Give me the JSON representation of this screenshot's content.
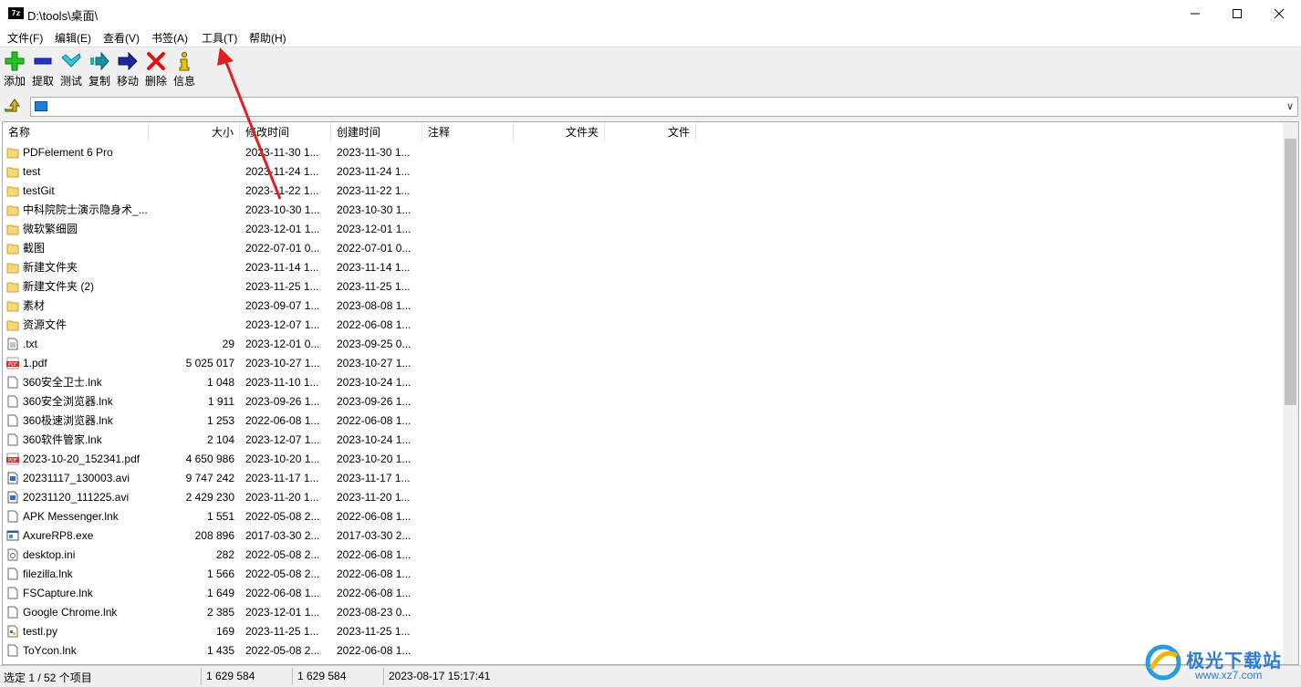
{
  "window": {
    "title": "D:\\tools\\桌面\\",
    "app_icon": "7z"
  },
  "menu": [
    "文件(F)",
    "编辑(E)",
    "查看(V)",
    "书签(A)",
    "工具(T)",
    "帮助(H)"
  ],
  "toolbar": {
    "buttons": [
      {
        "label": "添加",
        "icon": "plus-icon"
      },
      {
        "label": "提取",
        "icon": "minus-icon"
      },
      {
        "label": "测试",
        "icon": "check-icon"
      },
      {
        "label": "复制",
        "icon": "copy-arrow-icon"
      },
      {
        "label": "移动",
        "icon": "move-arrow-icon"
      },
      {
        "label": "删除",
        "icon": "delete-x-icon"
      },
      {
        "label": "信息",
        "icon": "info-icon"
      }
    ]
  },
  "columns": [
    "名称",
    "大小",
    "修改时间",
    "创建时间",
    "注释",
    "文件夹",
    "文件"
  ],
  "files": [
    {
      "name": "PDFelement 6 Pro",
      "size": "",
      "modified": "2023-11-30 1...",
      "created": "2023-11-30 1...",
      "type": "folder"
    },
    {
      "name": "test",
      "size": "",
      "modified": "2023-11-24 1...",
      "created": "2023-11-24 1...",
      "type": "folder"
    },
    {
      "name": "testGit",
      "size": "",
      "modified": "2023-11-22 1...",
      "created": "2023-11-22 1...",
      "type": "folder"
    },
    {
      "name": "中科院院士演示隐身术_...",
      "size": "",
      "modified": "2023-10-30 1...",
      "created": "2023-10-30 1...",
      "type": "folder"
    },
    {
      "name": "微软繁细圆",
      "size": "",
      "modified": "2023-12-01 1...",
      "created": "2023-12-01 1...",
      "type": "folder"
    },
    {
      "name": "截图",
      "size": "",
      "modified": "2022-07-01 0...",
      "created": "2022-07-01 0...",
      "type": "folder"
    },
    {
      "name": "新建文件夹",
      "size": "",
      "modified": "2023-11-14 1...",
      "created": "2023-11-14 1...",
      "type": "folder"
    },
    {
      "name": "新建文件夹 (2)",
      "size": "",
      "modified": "2023-11-25 1...",
      "created": "2023-11-25 1...",
      "type": "folder"
    },
    {
      "name": "素材",
      "size": "",
      "modified": "2023-09-07 1...",
      "created": "2023-08-08 1...",
      "type": "folder"
    },
    {
      "name": "资源文件",
      "size": "",
      "modified": "2023-12-07 1...",
      "created": "2022-06-08 1...",
      "type": "folder"
    },
    {
      "name": ".txt",
      "size": "29",
      "modified": "2023-12-01 0...",
      "created": "2023-09-25 0...",
      "type": "text"
    },
    {
      "name": "1.pdf",
      "size": "5 025 017",
      "modified": "2023-10-27 1...",
      "created": "2023-10-27 1...",
      "type": "pdf"
    },
    {
      "name": "360安全卫士.lnk",
      "size": "1 048",
      "modified": "2023-11-10 1...",
      "created": "2023-10-24 1...",
      "type": "file"
    },
    {
      "name": "360安全浏览器.lnk",
      "size": "1 911",
      "modified": "2023-09-26 1...",
      "created": "2023-09-26 1...",
      "type": "file"
    },
    {
      "name": "360极速浏览器.lnk",
      "size": "1 253",
      "modified": "2022-06-08 1...",
      "created": "2022-06-08 1...",
      "type": "file"
    },
    {
      "name": "360软件管家.lnk",
      "size": "2 104",
      "modified": "2023-12-07 1...",
      "created": "2023-10-24 1...",
      "type": "file"
    },
    {
      "name": "2023-10-20_152341.pdf",
      "size": "4 650 986",
      "modified": "2023-10-20 1...",
      "created": "2023-10-20 1...",
      "type": "pdf"
    },
    {
      "name": "20231117_130003.avi",
      "size": "9 747 242",
      "modified": "2023-11-17 1...",
      "created": "2023-11-17 1...",
      "type": "video"
    },
    {
      "name": "20231120_111225.avi",
      "size": "2 429 230",
      "modified": "2023-11-20 1...",
      "created": "2023-11-20 1...",
      "type": "video"
    },
    {
      "name": "APK Messenger.lnk",
      "size": "1 551",
      "modified": "2022-05-08 2...",
      "created": "2022-06-08 1...",
      "type": "file"
    },
    {
      "name": "AxureRP8.exe",
      "size": "208 896",
      "modified": "2017-03-30 2...",
      "created": "2017-03-30 2...",
      "type": "exe"
    },
    {
      "name": "desktop.ini",
      "size": "282",
      "modified": "2022-05-08 2...",
      "created": "2022-06-08 1...",
      "type": "ini"
    },
    {
      "name": "filezilla.lnk",
      "size": "1 566",
      "modified": "2022-05-08 2...",
      "created": "2022-06-08 1...",
      "type": "file"
    },
    {
      "name": "FSCapture.lnk",
      "size": "1 649",
      "modified": "2022-06-08 1...",
      "created": "2022-06-08 1...",
      "type": "file"
    },
    {
      "name": "Google Chrome.lnk",
      "size": "2 385",
      "modified": "2023-12-01 1...",
      "created": "2023-08-23 0...",
      "type": "file"
    },
    {
      "name": "testl.py",
      "size": "169",
      "modified": "2023-11-25 1...",
      "created": "2023-11-25 1...",
      "type": "py"
    },
    {
      "name": "ToYcon.lnk",
      "size": "1 435",
      "modified": "2022-05-08 2...",
      "created": "2022-06-08 1...",
      "type": "file"
    }
  ],
  "status": {
    "selection": "选定 1 / 52 个项目",
    "size1": "1 629 584",
    "size2": "1 629 584",
    "datetime": "2023-08-17 15:17:41"
  },
  "watermark": {
    "line1": "极光下载站",
    "line2": "www.xz7.com"
  },
  "colors": {
    "folder": "#f8d775",
    "pdf": "#d32f2f",
    "annotation_arrow": "#e02020"
  }
}
